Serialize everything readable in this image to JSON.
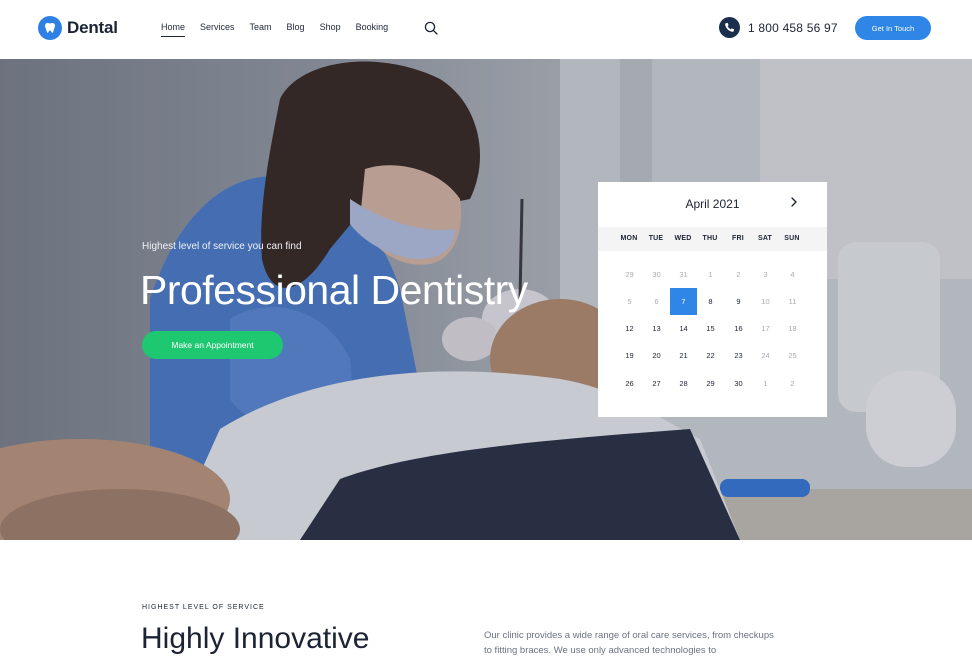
{
  "brand": {
    "name": "Dental"
  },
  "nav": {
    "items": [
      "Home",
      "Services",
      "Team",
      "Blog",
      "Shop",
      "Booking"
    ],
    "active_index": 0
  },
  "header": {
    "phone": "1 800 458 56 97",
    "cta_label": "Get In Touch"
  },
  "hero": {
    "overline": "Highest level of service you can find",
    "title": "Professional Dentistry",
    "cta_label": "Make an Appointment"
  },
  "calendar": {
    "month_label": "April 2021",
    "next_icon": "chevron-right-icon",
    "day_names": [
      "MON",
      "TUE",
      "WED",
      "THU",
      "FRI",
      "SAT",
      "SUN"
    ],
    "weeks": [
      [
        {
          "d": "29",
          "m": true
        },
        {
          "d": "30",
          "m": true
        },
        {
          "d": "31",
          "m": true
        },
        {
          "d": "1",
          "m": true
        },
        {
          "d": "2",
          "m": true
        },
        {
          "d": "3",
          "m": true
        },
        {
          "d": "4",
          "m": true
        }
      ],
      [
        {
          "d": "5",
          "m": true
        },
        {
          "d": "6",
          "m": true
        },
        {
          "d": "7",
          "sel": true
        },
        {
          "d": "8"
        },
        {
          "d": "9"
        },
        {
          "d": "10",
          "m": true
        },
        {
          "d": "11",
          "m": true
        }
      ],
      [
        {
          "d": "12"
        },
        {
          "d": "13"
        },
        {
          "d": "14"
        },
        {
          "d": "15"
        },
        {
          "d": "16"
        },
        {
          "d": "17",
          "m": true
        },
        {
          "d": "18",
          "m": true
        }
      ],
      [
        {
          "d": "19"
        },
        {
          "d": "20"
        },
        {
          "d": "21"
        },
        {
          "d": "22"
        },
        {
          "d": "23"
        },
        {
          "d": "24",
          "m": true
        },
        {
          "d": "25",
          "m": true
        }
      ],
      [
        {
          "d": "26"
        },
        {
          "d": "27"
        },
        {
          "d": "28"
        },
        {
          "d": "29"
        },
        {
          "d": "30"
        },
        {
          "d": "1",
          "m": true
        },
        {
          "d": "2",
          "m": true
        }
      ]
    ]
  },
  "section": {
    "overline": "HIGHEST LEVEL OF SERVICE",
    "title": "Highly Innovative",
    "text": "Our clinic provides a wide range of oral care services, from checkups to fitting braces. We use only advanced technologies to"
  },
  "colors": {
    "accent_blue": "#2f86e6",
    "accent_green": "#1ec871",
    "dark": "#1b2334"
  }
}
